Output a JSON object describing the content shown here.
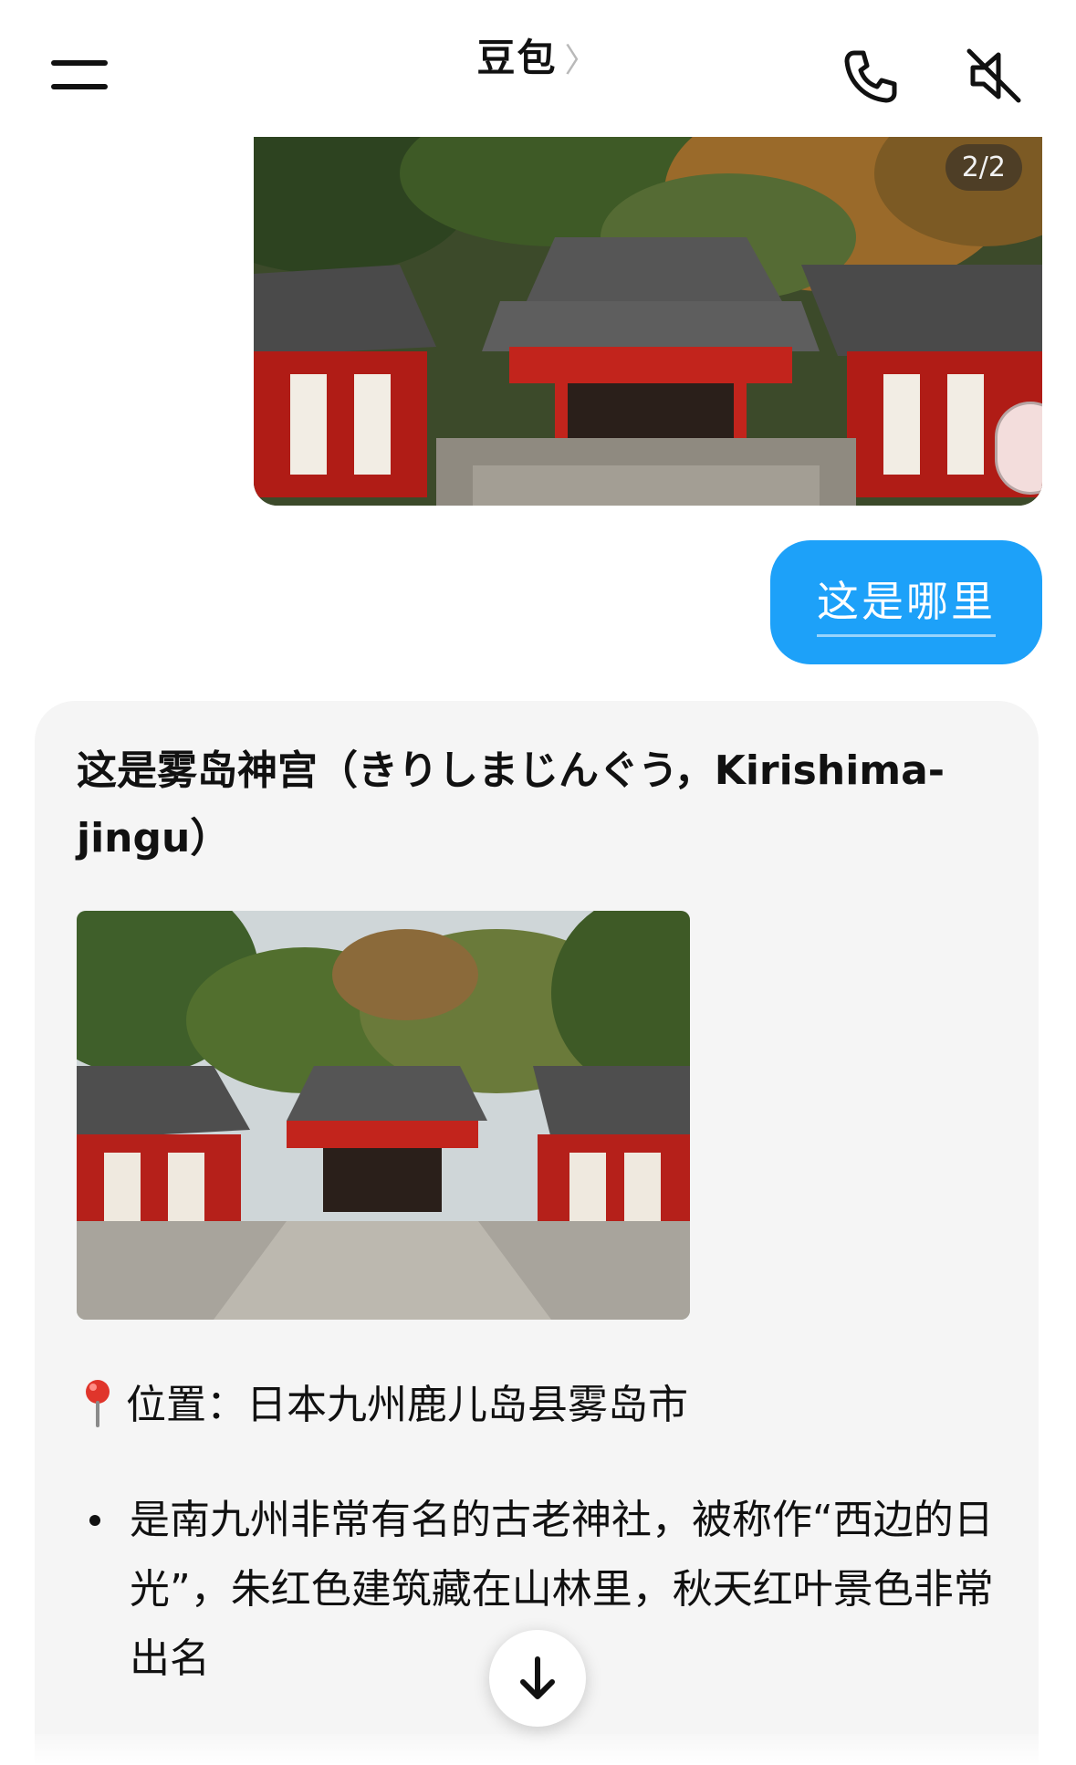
{
  "header": {
    "title": "豆包",
    "title_chevron": "〉",
    "icons": {
      "menu": "menu-icon",
      "call": "phone-icon",
      "mute": "speaker-mute-icon"
    }
  },
  "user_message": {
    "image_counter": "2/2",
    "text": "这是哪里",
    "bubble_color": "#1da1f9"
  },
  "assistant_message": {
    "heading": "这是雾岛神宫（きりしまじんぐう，Kirishima-jingu）",
    "location_label": "位置：",
    "location_value": "日本九州鹿儿岛县雾岛市",
    "location_icon": "pin-icon",
    "bullets": [
      "是南九州非常有名的古老神社，被称作“西边的日光”，朱红色建筑藏在山林里，秋天红叶景色非常出名"
    ],
    "card_color": "#f5f5f5"
  },
  "controls": {
    "scroll_down_icon": "arrow-down-icon"
  }
}
